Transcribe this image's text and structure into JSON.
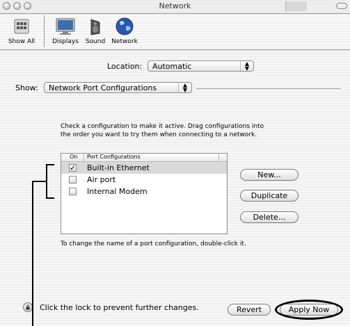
{
  "window": {
    "title": "Network"
  },
  "toolbar": {
    "show_all": "Show All",
    "displays": "Displays",
    "sound": "Sound",
    "network": "Network"
  },
  "location": {
    "label": "Location:",
    "value": "Automatic"
  },
  "show": {
    "label": "Show:",
    "value": "Network Port Configurations"
  },
  "description": "Check a configuration to make it active. Drag configurations into the order you want to try them when connecting to a network.",
  "list": {
    "col_on": "On",
    "col_name": "Port Configurations",
    "items": [
      {
        "name": "Built-in Ethernet",
        "checked": true
      },
      {
        "name": "Air port",
        "checked": false
      },
      {
        "name": "Internal Modem",
        "checked": false
      }
    ]
  },
  "buttons": {
    "new": "New...",
    "duplicate": "Duplicate",
    "delete": "Delete...",
    "revert": "Revert",
    "apply": "Apply Now"
  },
  "hint": "To change the name of a port configuration, double-click it.",
  "lock_text": "Click the lock to prevent further changes."
}
